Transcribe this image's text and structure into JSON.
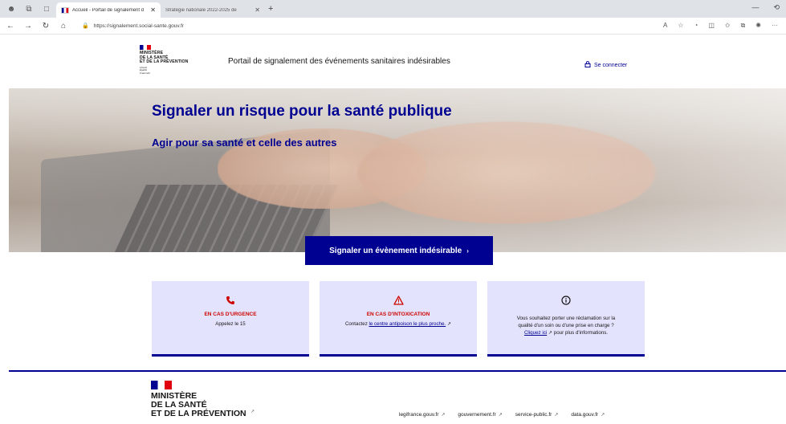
{
  "browser": {
    "tabs": [
      {
        "title": "Accueil - Portail de signalement d",
        "active": true
      },
      {
        "title": "Stratégie nationale 2022-2025 de",
        "active": false
      }
    ],
    "url": "https://signalement.social-sante.gouv.fr"
  },
  "header": {
    "ministry_lines": [
      "MINISTÈRE",
      "DE LA SANTÉ",
      "ET DE LA PRÉVENTION"
    ],
    "devise_lines": [
      "Liberté",
      "Égalité",
      "Fraternité"
    ],
    "site_title": "Portail de signalement des événements sanitaires indésirables",
    "login_label": "Se connecter"
  },
  "hero": {
    "title": "Signaler un risque pour la santé publique",
    "subtitle": "Agir pour sa santé et celle des autres",
    "cta_label": "Signaler un évènement indésirable"
  },
  "cards": [
    {
      "icon": "phone-icon",
      "heading": "EN CAS D'URGENCE",
      "body": "Appelez le 15"
    },
    {
      "icon": "warning-icon",
      "heading": "EN CAS D'INTOXICATION",
      "body_prefix": "Contactez ",
      "link": "le centre antipoison le plus proche."
    },
    {
      "icon": "info-icon",
      "body_line1": "Vous souhaitez porter une réclamation sur la",
      "body_line2": "qualité d'un soin ou d'une prise en charge ?",
      "link": "Cliquez ici",
      "body_suffix": " pour plus d'informations."
    }
  ],
  "footer": {
    "ministry_lines": [
      "MINISTÈRE",
      "DE LA SANTÉ",
      "ET DE LA PRÉVENTION"
    ],
    "links": [
      "legifrance.gouv.fr",
      "gouvernement.fr",
      "service-public.fr",
      "data.gouv.fr"
    ]
  },
  "colors": {
    "primary": "#000091",
    "danger": "#ce0500",
    "card_bg": "#e3e3fd"
  }
}
